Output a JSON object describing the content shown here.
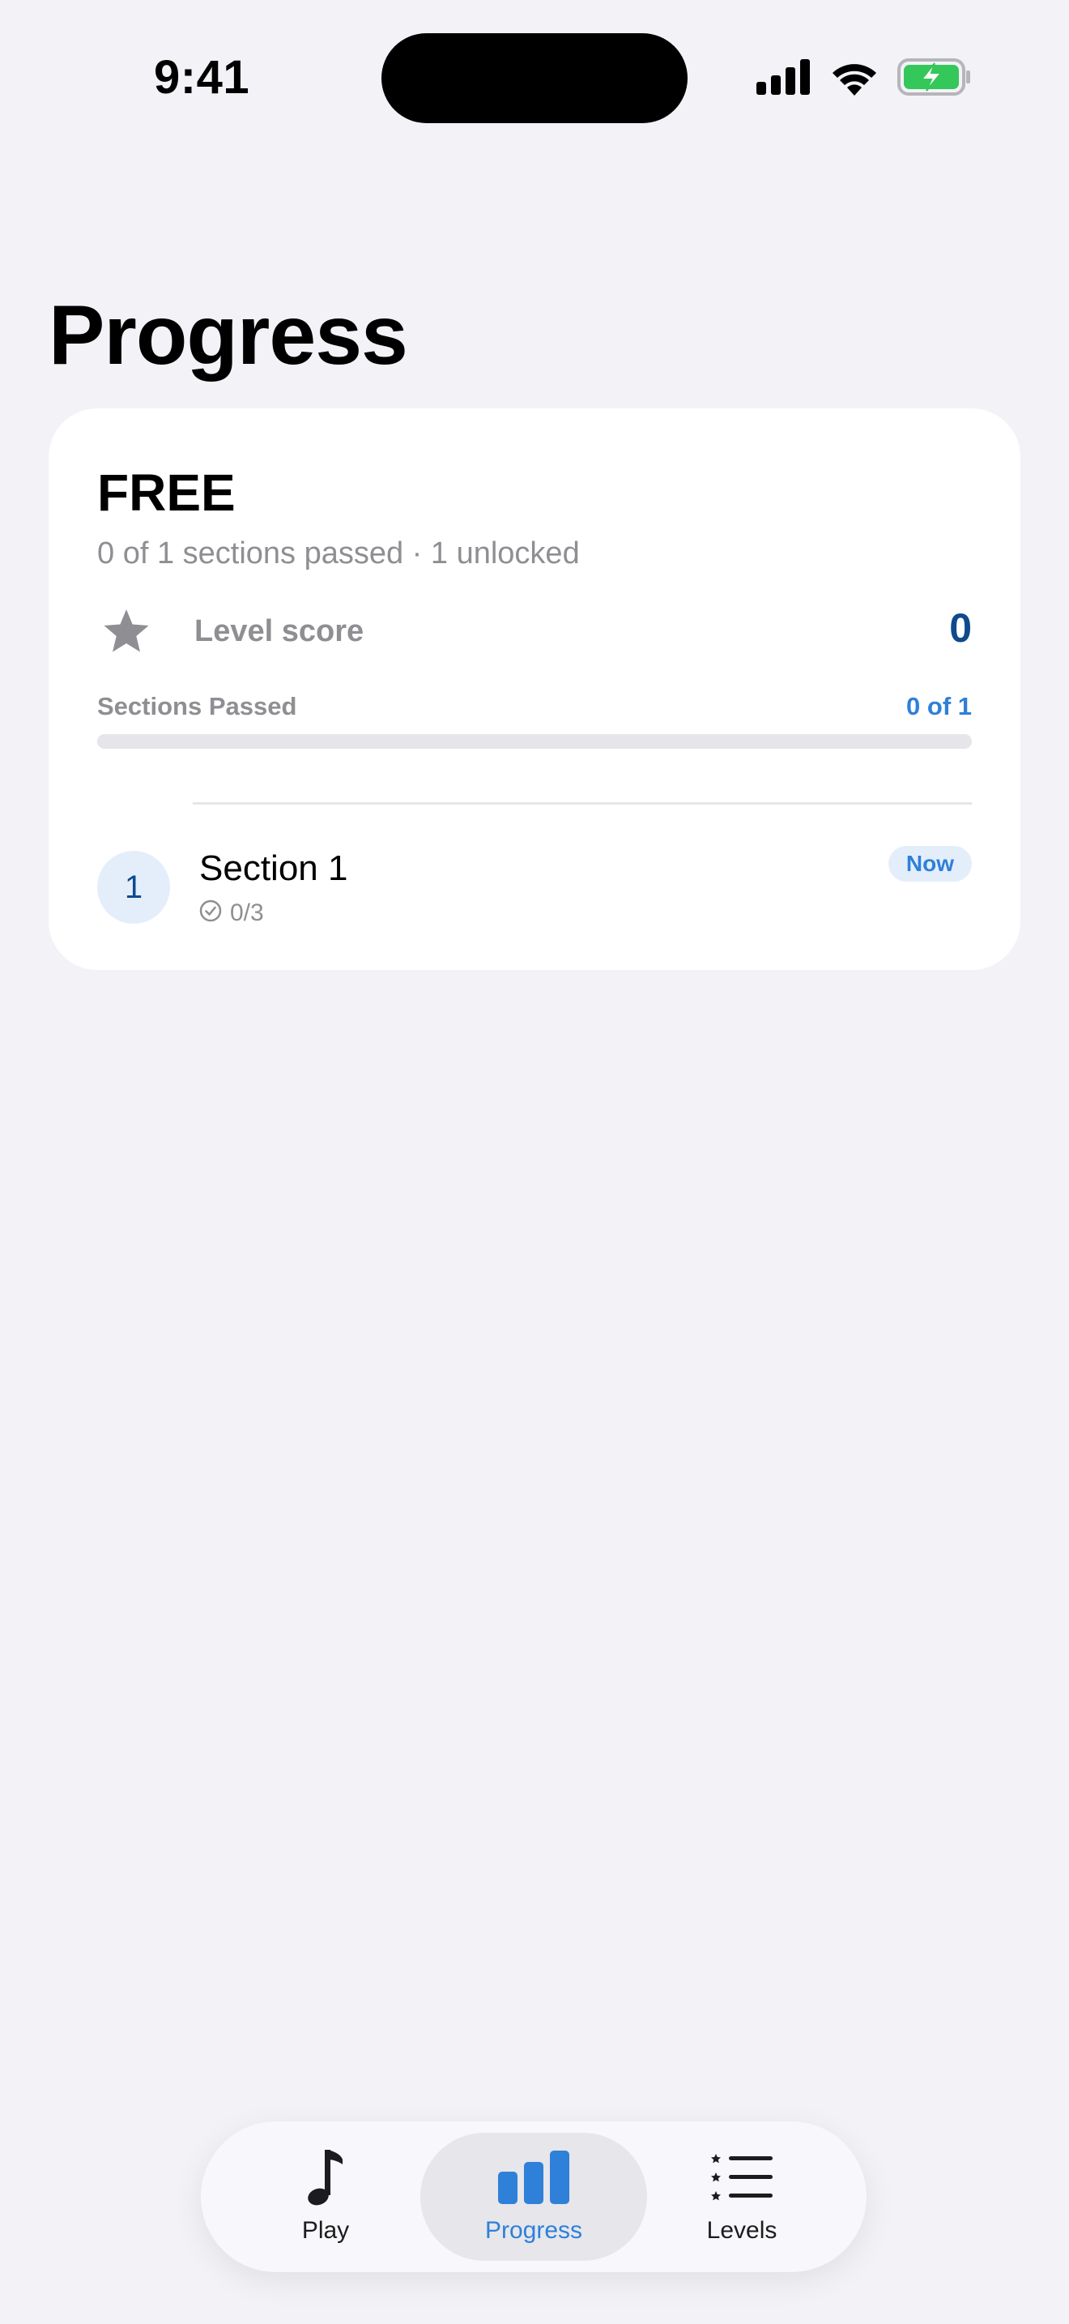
{
  "status_bar": {
    "time": "9:41"
  },
  "page": {
    "title": "Progress"
  },
  "card": {
    "title": "FREE",
    "subtitle": "0 of 1 sections passed · 1 unlocked",
    "score": {
      "label": "Level score",
      "value": "0",
      "icon": "star-icon"
    },
    "sections_passed": {
      "label": "Sections Passed",
      "value": "0 of 1",
      "progress": 0
    },
    "sections": [
      {
        "number": "1",
        "name": "Section 1",
        "count": "0/3",
        "badge": "Now"
      }
    ]
  },
  "tab_bar": {
    "tabs": [
      {
        "label": "Play",
        "icon": "music-note-icon",
        "active": false
      },
      {
        "label": "Progress",
        "icon": "bar-chart-icon",
        "active": true
      },
      {
        "label": "Levels",
        "icon": "list-stars-icon",
        "active": false
      }
    ]
  },
  "colors": {
    "background": "#f2f2f7",
    "accent": "#2f80d8",
    "accent_dark": "#0f4a8e",
    "secondary_text": "#8e8e93",
    "battery_green": "#34c759"
  }
}
